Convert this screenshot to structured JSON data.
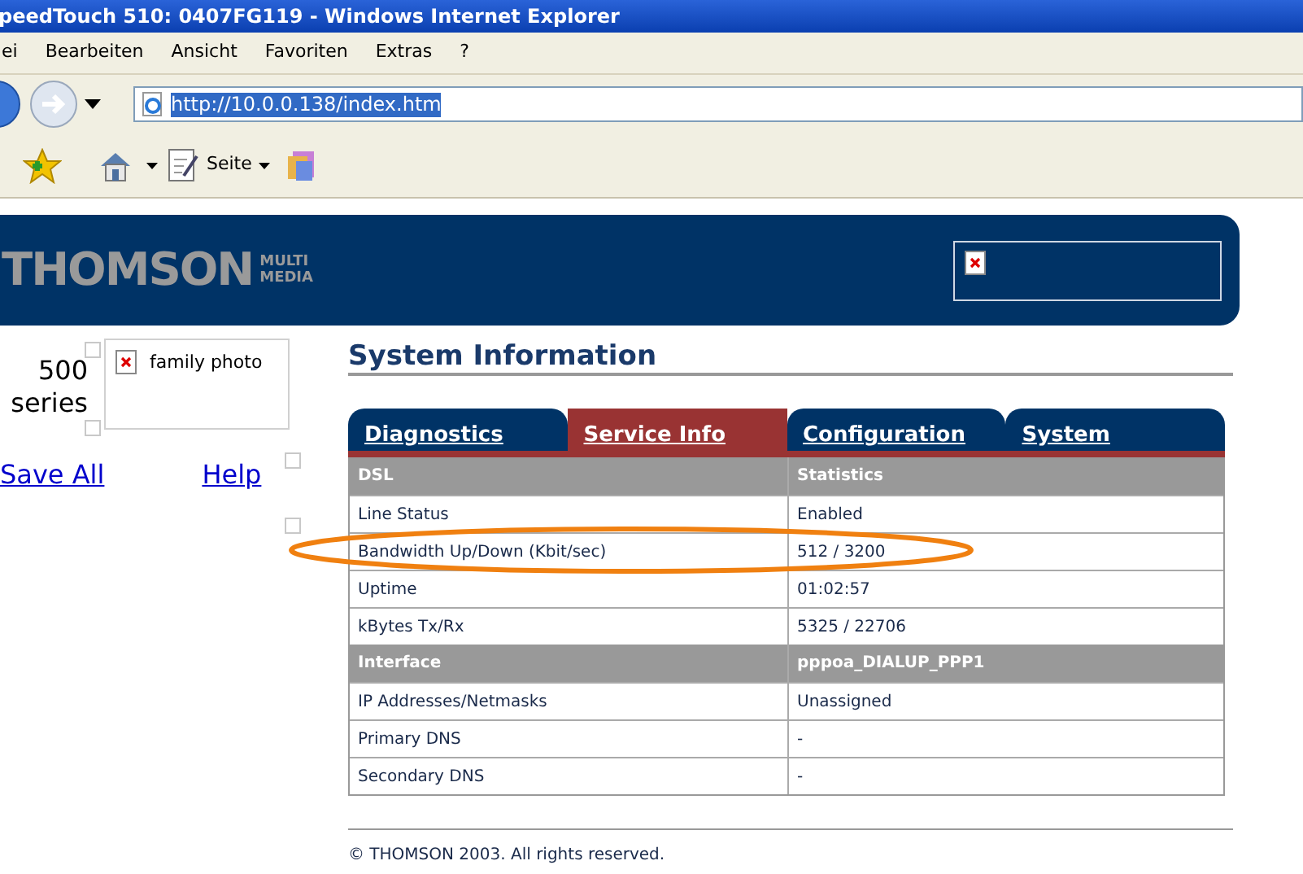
{
  "window": {
    "title": "peedTouch 510:  0407FG119 - Windows Internet Explorer"
  },
  "menu": [
    "ei",
    "Bearbeiten",
    "Ansicht",
    "Favoriten",
    "Extras",
    "?"
  ],
  "address": {
    "value": "http://10.0.0.138/index.htm"
  },
  "toolbar": {
    "page_label": "Seite"
  },
  "banner": {
    "logo": "THOMSON",
    "logo_sub": [
      "MULTI",
      "MEDIA"
    ]
  },
  "sidebar": {
    "model_lines": [
      "500",
      "series"
    ],
    "image_alt": "family photo",
    "links": [
      "Save All",
      "Help"
    ]
  },
  "heading": "System Information",
  "tabs": [
    {
      "label": "Diagnostics",
      "selected": false
    },
    {
      "label": "Service Info",
      "selected": true
    },
    {
      "label": "Configuration",
      "selected": false
    },
    {
      "label": "System",
      "selected": false
    }
  ],
  "table": {
    "rows": [
      {
        "kind": "header",
        "cells": [
          "DSL",
          "Statistics"
        ]
      },
      {
        "kind": "data",
        "cells": [
          "Line Status",
          "Enabled"
        ]
      },
      {
        "kind": "data",
        "cells": [
          "Bandwidth Up/Down (Kbit/sec)",
          "512 / 3200"
        ],
        "circled": true
      },
      {
        "kind": "data",
        "cells": [
          "Uptime",
          "01:02:57"
        ]
      },
      {
        "kind": "data",
        "cells": [
          "kBytes Tx/Rx",
          "5325 / 22706"
        ]
      },
      {
        "kind": "header",
        "cells": [
          "Interface",
          "pppoa_DIALUP_PPP1"
        ]
      },
      {
        "kind": "data",
        "cells": [
          "IP Addresses/Netmasks",
          "Unassigned"
        ]
      },
      {
        "kind": "data",
        "cells": [
          "Primary DNS",
          "-"
        ]
      },
      {
        "kind": "data",
        "cells": [
          "Secondary DNS",
          "-"
        ]
      }
    ]
  },
  "footer": "© THOMSON 2003. All rights reserved."
}
